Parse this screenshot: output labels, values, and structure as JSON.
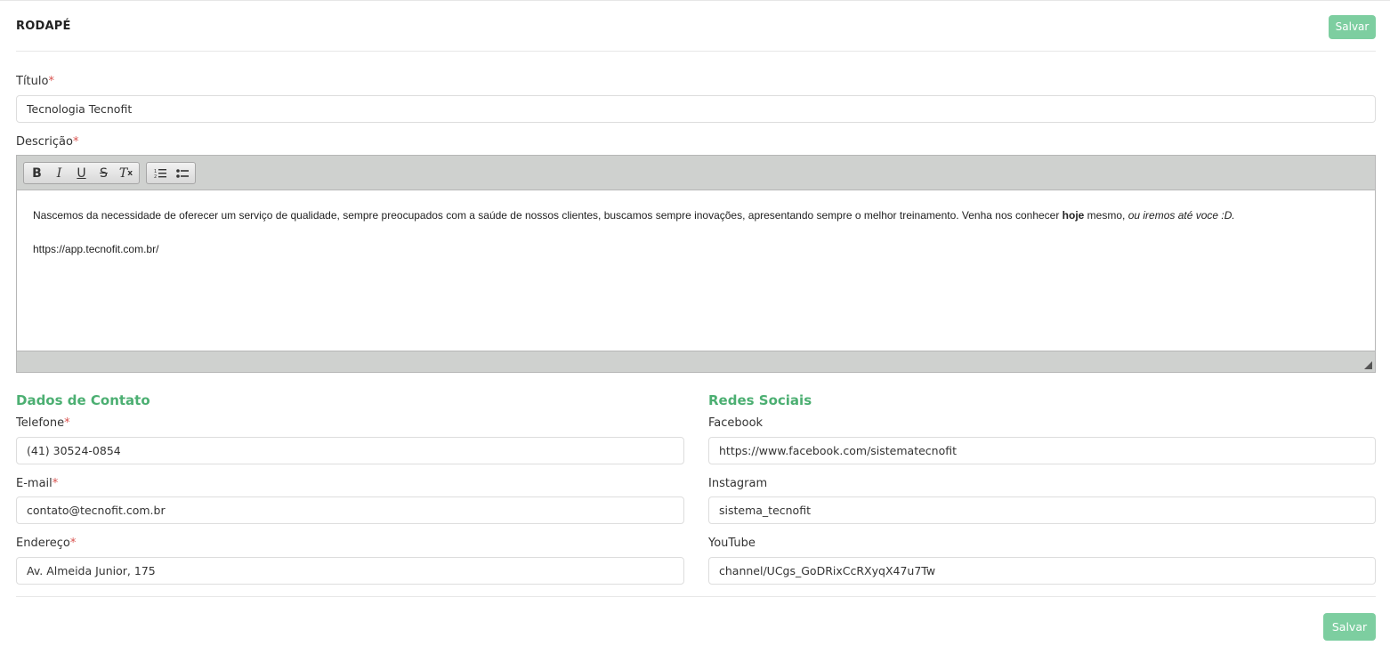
{
  "header": {
    "title": "RODAPÉ",
    "save_label": "Salvar"
  },
  "form": {
    "titulo": {
      "label": "Título",
      "required_mark": "*",
      "value": "Tecnologia Tecnofit"
    },
    "descricao": {
      "label": "Descrição",
      "required_mark": "*",
      "toolbar": {
        "bold": "B",
        "italic": "I",
        "underline": "U",
        "strike": "S",
        "clear": "T",
        "clear_sub": "x",
        "ordered_list": "1≡",
        "bullet_list": "•≡"
      },
      "paragraph_1_plain": "Nascemos da necessidade de oferecer um serviço de qualidade, sempre preocupados com a saúde de nossos clientes, buscamos sempre inovações, apresentando sempre o melhor treinamento. Venha nos conhecer ",
      "paragraph_1_bold": "hoje",
      "paragraph_1_after": " mesmo, ",
      "paragraph_1_italic": "ou iremos até voce :D.",
      "paragraph_2": "https://app.tecnofit.com.br/"
    }
  },
  "contato": {
    "title": "Dados de Contato",
    "telefone": {
      "label": "Telefone",
      "required_mark": "*",
      "value": "(41) 30524-0854"
    },
    "email": {
      "label": "E-mail",
      "required_mark": "*",
      "value": "contato@tecnofit.com.br"
    },
    "endereco": {
      "label": "Endereço",
      "required_mark": "*",
      "value": "Av. Almeida Junior, 175"
    }
  },
  "redes": {
    "title": "Redes Sociais",
    "facebook": {
      "label": "Facebook",
      "value": "https://www.facebook.com/sistematecnofit"
    },
    "instagram": {
      "label": "Instagram",
      "value": "sistema_tecnofit"
    },
    "youtube": {
      "label": "YouTube",
      "value": "channel/UCgs_GoDRixCcRXyqX47u7Tw"
    }
  },
  "footer": {
    "save_label": "Salvar"
  },
  "colors": {
    "accent_green": "#4caf72",
    "button_green": "#7dcea0",
    "required_red": "#d9534f"
  }
}
